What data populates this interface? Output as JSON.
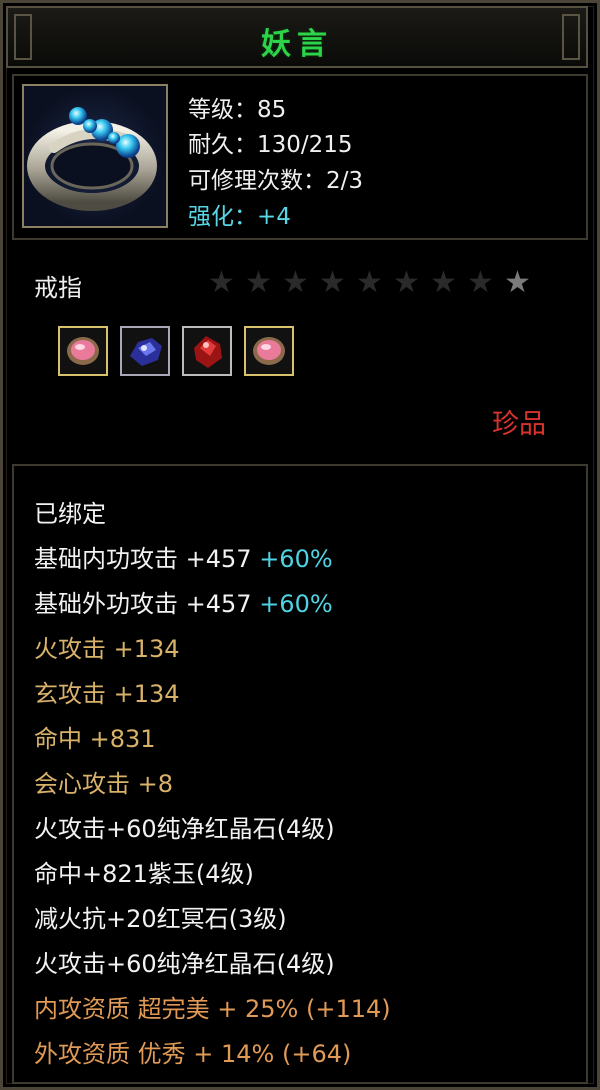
{
  "item": {
    "name": "妖言",
    "type": "戒指",
    "level": "等级：85",
    "durability": "耐久：130/215",
    "repair": "可修理次数：2/3",
    "enhance": "强化：+4",
    "rarity": "珍品",
    "stars_total": 9,
    "stars_lit": 1
  },
  "gems": [
    "pink-crystal-icon",
    "blue-crystal-icon",
    "red-crystal-icon",
    "pink-crystal-icon"
  ],
  "attributes": {
    "bound": "已绑定",
    "inner_attack_label": "基础内功攻击 +457",
    "inner_attack_bonus": "+60%",
    "outer_attack_label": "基础外功攻击 +457",
    "outer_attack_bonus": "+60%",
    "fire_attack": "火攻击 +134",
    "xuan_attack": "玄攻击 +134",
    "hit": "命中 +831",
    "crit": "会心攻击 +8",
    "gem1": "火攻击+60纯净红晶石(4级)",
    "gem2": "命中+821紫玉(4级)",
    "gem3": "减火抗+20红冥石(3级)",
    "gem4": "火攻击+60纯净红晶石(4级)",
    "inner_quality": "内攻资质 超完美 + 25% (+114)",
    "outer_quality": "外攻资质 优秀 + 14% (+64)"
  },
  "colors": {
    "title": "#2dd44a",
    "rarity": "#d7332c",
    "enhance": "#58d6e6",
    "attribute_gold": "#d9b26a",
    "quality_orange": "#e19a55"
  }
}
